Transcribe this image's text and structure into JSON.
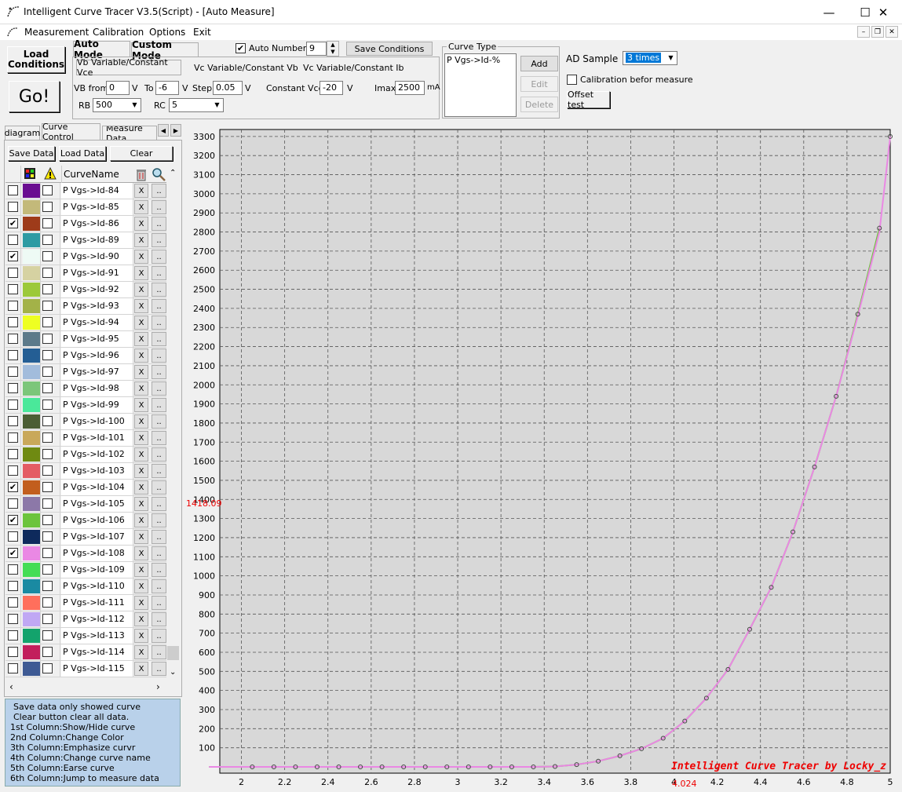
{
  "window": {
    "title": "Intelligent Curve Tracer V3.5(Script) - [Auto Measure]"
  },
  "menu": [
    "Measurement",
    "Calibration",
    "Options",
    "Exit"
  ],
  "left_buttons": {
    "load": "Load\nConditions",
    "go": "Go!"
  },
  "mode_tabs": [
    "Auto Mode",
    "Custom Mode"
  ],
  "sub_tabs": [
    "Vb Variable/Constant Vce",
    "Vc Variable/Constant Vb",
    "Vc Variable/Constant Ib"
  ],
  "auto_number": {
    "label": "Auto Number",
    "checked": true,
    "value": "9"
  },
  "save_conditions": "Save Conditions",
  "params": {
    "vb_from_label": "VB from",
    "vb_from": "0",
    "v1": "V",
    "to_label": "To",
    "to": "-6",
    "v2": "V",
    "step_label": "Step",
    "step": "0.05",
    "v3": "V",
    "vce_label": "Constant Vce",
    "vce": "-20",
    "v4": "V",
    "imax_label": "Imax",
    "imax": "2500",
    "ma": "mA",
    "rb_label": "RB",
    "rb": "500",
    "rc_label": "RC",
    "rc": "5"
  },
  "curve_type": {
    "title": "Curve Type",
    "items": [
      "P Vgs->Id-%"
    ],
    "add": "Add",
    "edit": "Edit",
    "delete": "Delete"
  },
  "ad_sample": {
    "label": "AD Sample",
    "value": "3 times"
  },
  "calibration_check": {
    "label": "Calibration befor measure",
    "checked": false
  },
  "offset_test": "Offset test",
  "side_tabs": [
    "diagram",
    "Curve Control",
    "Measure Data"
  ],
  "side_buttons": {
    "save": "Save Data",
    "load": "Load Data",
    "clear": "Clear"
  },
  "grid_header": {
    "name": "CurveName"
  },
  "curves": [
    {
      "name": "P Vgs->Id-84",
      "color": "#6a0d91",
      "show": false
    },
    {
      "name": "P Vgs->Id-85",
      "color": "#c3b97a",
      "show": false
    },
    {
      "name": "P Vgs->Id-86",
      "color": "#9e3b1a",
      "show": true
    },
    {
      "name": "P Vgs->Id-89",
      "color": "#2e9aa3",
      "show": false
    },
    {
      "name": "P Vgs->Id-90",
      "color": "#eefaf5",
      "show": true
    },
    {
      "name": "P Vgs->Id-91",
      "color": "#d6d2a2",
      "show": false
    },
    {
      "name": "P Vgs->Id-92",
      "color": "#9cc93a",
      "show": false
    },
    {
      "name": "P Vgs->Id-93",
      "color": "#a3b248",
      "show": false
    },
    {
      "name": "P Vgs->Id-94",
      "color": "#eeff22",
      "show": false
    },
    {
      "name": "P Vgs->Id-95",
      "color": "#5c7a8a",
      "show": false
    },
    {
      "name": "P Vgs->Id-96",
      "color": "#245e94",
      "show": false
    },
    {
      "name": "P Vgs->Id-97",
      "color": "#a2bcdc",
      "show": false
    },
    {
      "name": "P Vgs->Id-98",
      "color": "#7cc67a",
      "show": false
    },
    {
      "name": "P Vgs->Id-99",
      "color": "#4ae89a",
      "show": false
    },
    {
      "name": "P Vgs->Id-100",
      "color": "#4b5e34",
      "show": false
    },
    {
      "name": "P Vgs->Id-101",
      "color": "#c9a85a",
      "show": false
    },
    {
      "name": "P Vgs->Id-102",
      "color": "#6f8a12",
      "show": false
    },
    {
      "name": "P Vgs->Id-103",
      "color": "#e45c64",
      "show": false
    },
    {
      "name": "P Vgs->Id-104",
      "color": "#c25e1e",
      "show": true
    },
    {
      "name": "P Vgs->Id-105",
      "color": "#8c78a8",
      "show": false
    },
    {
      "name": "P Vgs->Id-106",
      "color": "#6cc43c",
      "show": true
    },
    {
      "name": "P Vgs->Id-107",
      "color": "#0e2a5c",
      "show": false
    },
    {
      "name": "P Vgs->Id-108",
      "color": "#ea88e4",
      "show": true
    },
    {
      "name": "P Vgs->Id-109",
      "color": "#44dd55",
      "show": false
    },
    {
      "name": "P Vgs->Id-110",
      "color": "#1a8aa2",
      "show": false
    },
    {
      "name": "P Vgs->Id-111",
      "color": "#ff6f5c",
      "show": false
    },
    {
      "name": "P Vgs->Id-112",
      "color": "#c0a8f4",
      "show": false
    },
    {
      "name": "P Vgs->Id-113",
      "color": "#13a36c",
      "show": false
    },
    {
      "name": "P Vgs->Id-114",
      "color": "#c21e5c",
      "show": false
    },
    {
      "name": "P Vgs->Id-115",
      "color": "#3e5a94",
      "show": false
    }
  ],
  "info": [
    "Save data only showed curve",
    "Clear button clear all data.",
    "1st Column:Show/Hide curve",
    "2nd Column:Change Color",
    "3th Column:Emphasize curvr",
    "4th Column:Change curve name",
    "5th Column:Earse curve",
    "6th Column:Jump to measure data"
  ],
  "chart_data": {
    "type": "line",
    "xlim": [
      1.9,
      5.0
    ],
    "ylim": [
      0,
      3320
    ],
    "xticks": [
      2,
      2.2,
      2.4,
      2.6,
      2.8,
      3,
      3.2,
      3.4,
      3.6,
      3.8,
      4,
      4.2,
      4.4,
      4.6,
      4.8,
      5
    ],
    "yticks": [
      100,
      200,
      300,
      400,
      500,
      600,
      700,
      800,
      900,
      1000,
      1100,
      1200,
      1300,
      1400,
      1500,
      1600,
      1700,
      1800,
      1900,
      2000,
      2100,
      2200,
      2300,
      2400,
      2500,
      2600,
      2700,
      2800,
      2900,
      3000,
      3100,
      3200,
      3300
    ],
    "series": [
      {
        "color": "#6cc43c",
        "x": [
          1.85,
          2.05,
          2.15,
          2.25,
          2.35,
          2.45,
          2.55,
          2.65,
          2.75,
          2.85,
          2.95,
          3.05,
          3.15,
          3.25,
          3.35,
          3.45,
          3.55,
          3.65,
          3.75,
          3.85,
          3.95,
          4.05,
          4.15,
          4.25,
          4.35,
          4.45,
          4.55,
          4.65,
          4.75,
          4.85,
          4.95
        ],
        "y": [
          0,
          0,
          0,
          0,
          0,
          0,
          0,
          0,
          0,
          0,
          0,
          0,
          0,
          0,
          0,
          2,
          12,
          30,
          58,
          95,
          150,
          240,
          360,
          510,
          720,
          940,
          1230,
          1570,
          1940,
          2370,
          2820
        ]
      },
      {
        "color": "#ea88e4",
        "x": [
          1.85,
          2.05,
          2.15,
          2.25,
          2.35,
          2.45,
          2.55,
          2.65,
          2.75,
          2.85,
          2.95,
          3.05,
          3.15,
          3.25,
          3.35,
          3.45,
          3.55,
          3.65,
          3.75,
          3.85,
          3.95,
          4.05,
          4.15,
          4.25,
          4.35,
          4.45,
          4.55,
          4.65,
          4.75,
          4.85,
          4.95,
          5.0
        ],
        "y": [
          0,
          0,
          0,
          0,
          0,
          0,
          0,
          0,
          0,
          0,
          0,
          0,
          0,
          0,
          0,
          2,
          12,
          30,
          58,
          95,
          150,
          240,
          360,
          510,
          720,
          940,
          1230,
          1570,
          1940,
          2360,
          2800,
          3300
        ]
      }
    ],
    "markers": [
      {
        "x": 2.05,
        "y": 0
      },
      {
        "x": 2.15,
        "y": 0
      },
      {
        "x": 2.25,
        "y": 0
      },
      {
        "x": 2.35,
        "y": 0
      },
      {
        "x": 2.45,
        "y": 0
      },
      {
        "x": 2.55,
        "y": 0
      },
      {
        "x": 2.65,
        "y": 0
      },
      {
        "x": 2.75,
        "y": 0
      },
      {
        "x": 2.85,
        "y": 0
      },
      {
        "x": 2.95,
        "y": 0
      },
      {
        "x": 3.05,
        "y": 0
      },
      {
        "x": 3.15,
        "y": 0
      },
      {
        "x": 3.25,
        "y": 0
      },
      {
        "x": 3.35,
        "y": 0
      },
      {
        "x": 3.45,
        "y": 2
      },
      {
        "x": 3.55,
        "y": 12
      },
      {
        "x": 3.65,
        "y": 30
      },
      {
        "x": 3.75,
        "y": 58
      },
      {
        "x": 3.85,
        "y": 95
      },
      {
        "x": 3.95,
        "y": 150
      },
      {
        "x": 4.05,
        "y": 240
      },
      {
        "x": 4.15,
        "y": 360
      },
      {
        "x": 4.25,
        "y": 510
      },
      {
        "x": 4.35,
        "y": 720
      },
      {
        "x": 4.45,
        "y": 940
      },
      {
        "x": 4.55,
        "y": 1230
      },
      {
        "x": 4.65,
        "y": 1570
      },
      {
        "x": 4.75,
        "y": 1940
      },
      {
        "x": 4.85,
        "y": 2370
      },
      {
        "x": 4.95,
        "y": 2820
      },
      {
        "x": 5.0,
        "y": 3300
      }
    ],
    "cursor": {
      "x_label": "4.024",
      "y_label": "1418.09"
    },
    "watermark": "Intelligent Curve Tracer by Locky_z",
    "grid": true
  }
}
